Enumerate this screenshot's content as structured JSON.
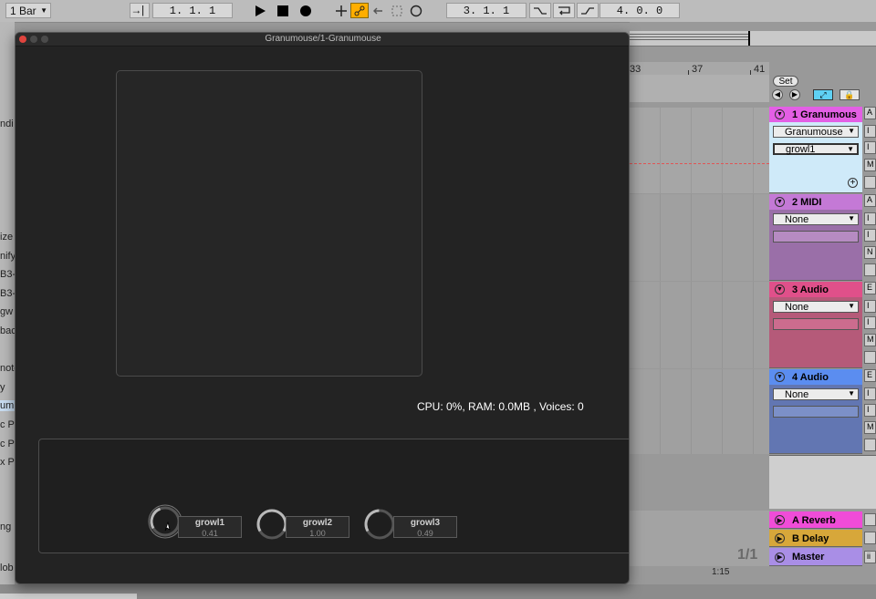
{
  "toolbar": {
    "quantize": "1 Bar",
    "position": "1.   1.   1",
    "loop_start": "3.   1.   1",
    "loop_length": "4.   0.   0"
  },
  "ruler": {
    "bars": [
      "33",
      "37",
      "41"
    ],
    "set_label": "Set"
  },
  "tracks": [
    {
      "name": "1 Granumous",
      "input": "Granumouse",
      "channel": "growl1",
      "color": "#e35fe5",
      "body": "#cfeaf9"
    },
    {
      "name": "2 MIDI",
      "input": "None",
      "color": "#c479d6",
      "body": "#9a6fa8"
    },
    {
      "name": "3 Audio",
      "input": "None",
      "color": "#e0508a",
      "body": "#b55a79"
    },
    {
      "name": "4 Audio",
      "input": "None",
      "color": "#5b8df0",
      "body": "#6276b2"
    }
  ],
  "returns": [
    {
      "name": "A Reverb",
      "color": "#f04cd8"
    },
    {
      "name": "B Delay",
      "color": "#d7a73a"
    },
    {
      "name": "Master",
      "color": "#a98ee6"
    }
  ],
  "footer": {
    "page": "1/1",
    "time": "1:15"
  },
  "left_labels": [
    "ndi",
    "ize",
    "nify",
    "B3-",
    "B3-",
    "gw",
    "bac",
    "note",
    "y",
    "um",
    "c P",
    "c P",
    "x P",
    "ng",
    "lob"
  ],
  "plugin": {
    "title": "Granumouse/1-Granumouse",
    "stats": "CPU: 0%, RAM: 0.0MB , Voices: 0",
    "knobs": [
      {
        "name": "growl1",
        "value": "0.41",
        "level": 0.41
      },
      {
        "name": "growl2",
        "value": "1.00",
        "level": 1.0
      },
      {
        "name": "growl3",
        "value": "0.49",
        "level": 0.49
      }
    ]
  },
  "colors": {
    "accent": "#ffae00",
    "track_active": "#cfeaf9"
  }
}
